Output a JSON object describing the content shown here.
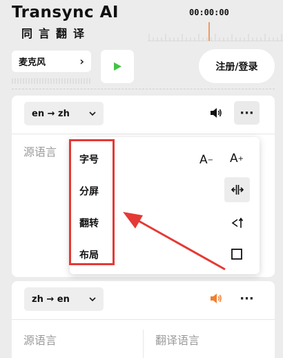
{
  "header": {
    "title": "Transync AI",
    "subtitle": "同言翻译",
    "timer": "00:00:00"
  },
  "controls": {
    "mic_label": "麦克风",
    "login_label": "注册/登录"
  },
  "top_panel": {
    "direction": "en → zh",
    "source_placeholder": "源语言"
  },
  "menu": {
    "items": [
      {
        "label": "字号"
      },
      {
        "label": "分屏"
      },
      {
        "label": "翻转"
      },
      {
        "label": "布局"
      }
    ],
    "font_decrease": "A",
    "font_increase": "A"
  },
  "bottom_panel": {
    "direction": "zh → en",
    "source_placeholder": "源语言",
    "target_placeholder": "翻译语言"
  },
  "colors": {
    "play_green": "#43c443",
    "accent_orange": "#f08030",
    "highlight_red": "#e53935",
    "playhead_orange": "#f08030"
  }
}
